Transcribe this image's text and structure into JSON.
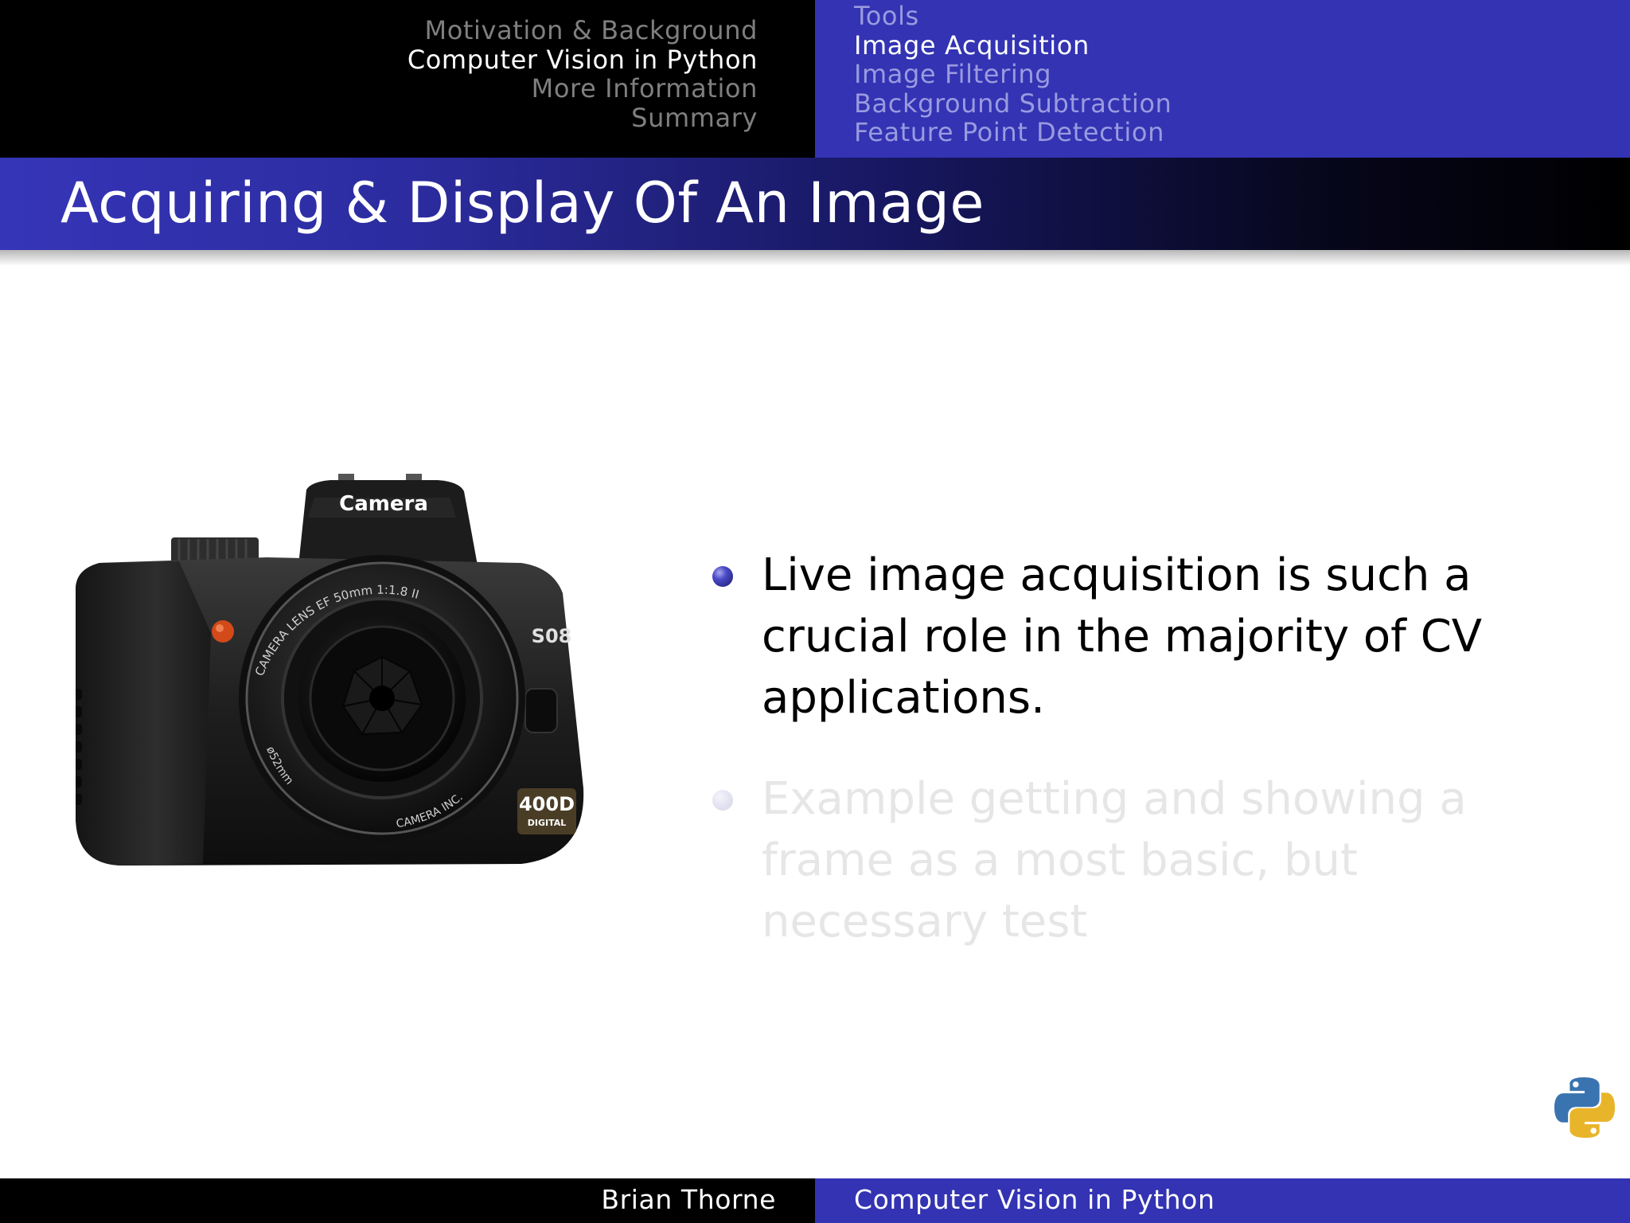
{
  "header": {
    "sections": [
      {
        "label": "Motivation & Background",
        "active": false
      },
      {
        "label": "Computer Vision in Python",
        "active": true
      },
      {
        "label": "More Information",
        "active": false
      },
      {
        "label": "Summary",
        "active": false
      }
    ],
    "subsections": [
      {
        "label": "Tools",
        "active": false
      },
      {
        "label": "Image Acquisition",
        "active": true
      },
      {
        "label": "Image Filtering",
        "active": false
      },
      {
        "label": "Background Subtraction",
        "active": false
      },
      {
        "label": "Feature Point Detection",
        "active": false
      }
    ]
  },
  "slide": {
    "title": "Acquiring & Display Of An Image",
    "bullets": [
      {
        "text": "Live image acquisition is such a crucial role in the majority of CV applications.",
        "dimmed": false
      },
      {
        "text": "Example getting and showing a frame as a most basic, but necessary test",
        "dimmed": true
      }
    ],
    "camera": {
      "brand": "Camera",
      "lens_text": "CAMERA LENS EF 50mm 1:1.8 II",
      "lens_bottom_left": "ø52mm",
      "lens_bottom_right": "CAMERA INC.",
      "side_badge": "S08",
      "model_number": "400D",
      "model_sub": "DIGITAL"
    }
  },
  "footer": {
    "author": "Brian Thorne",
    "title": "Computer Vision in Python"
  },
  "colors": {
    "beamer_blue": "#3333b3",
    "header_black": "#000000",
    "dim_text": "#e6e6e6"
  }
}
